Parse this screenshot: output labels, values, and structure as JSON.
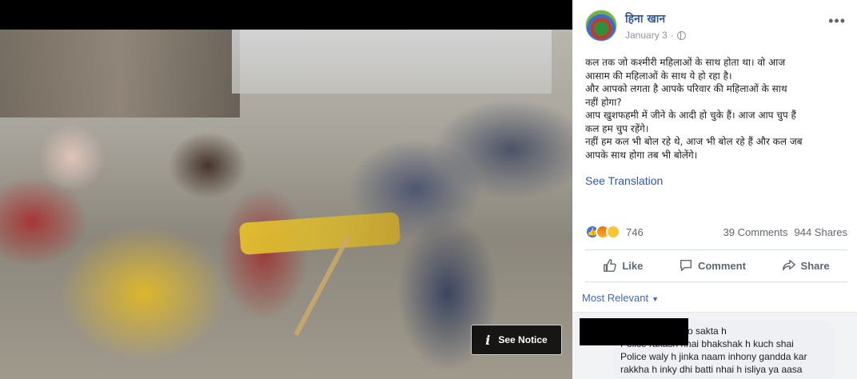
{
  "post": {
    "author": "हिना खान",
    "date": "January 3",
    "more_label": "•••",
    "text_lines": [
      "कल तक जो कश्मीरी महिलाओं के साथ होता था। वो आज",
      "आसाम की महिलाओं के साथ ये हो रहा है।",
      "और आपको लगता है आपके परिवार की महिलाओं के साथ",
      "नहीं होगा?",
      "आप खुशफहमी में जीने के आदी हो चुके हैं। आज आप चुप हैं",
      "कल हम चुप रहेंगे।",
      "नहीं हम कल भी बोल रहे थे, आज भी बोल रहे हैं और कल जब",
      "आपके साथ होगा तब भी बोलेंगे।"
    ],
    "see_translation": "See Translation"
  },
  "stats": {
    "reaction_count": "746",
    "comments": "39 Comments",
    "shares": "944 Shares",
    "reactions": [
      "like-icon",
      "angry-icon",
      "sad-icon"
    ]
  },
  "actions": {
    "like": "Like",
    "comment": "Comment",
    "share": "Share"
  },
  "comments": {
    "sort_label": "Most Relevant",
    "first_comment_lines": [
      "Kici k saat bhi ho sakta h",
      "Police rakash nhai bhakshak h kuch shai",
      "Police waly h jinka naam inhony gandda kar",
      "rakkha h inky dhi batti nhai h isliya ya aasa"
    ]
  },
  "photo": {
    "notice_label": "See Notice"
  },
  "colors": {
    "link": "#365899",
    "secondary_text": "#606770",
    "like_blue": "#3578e5"
  }
}
